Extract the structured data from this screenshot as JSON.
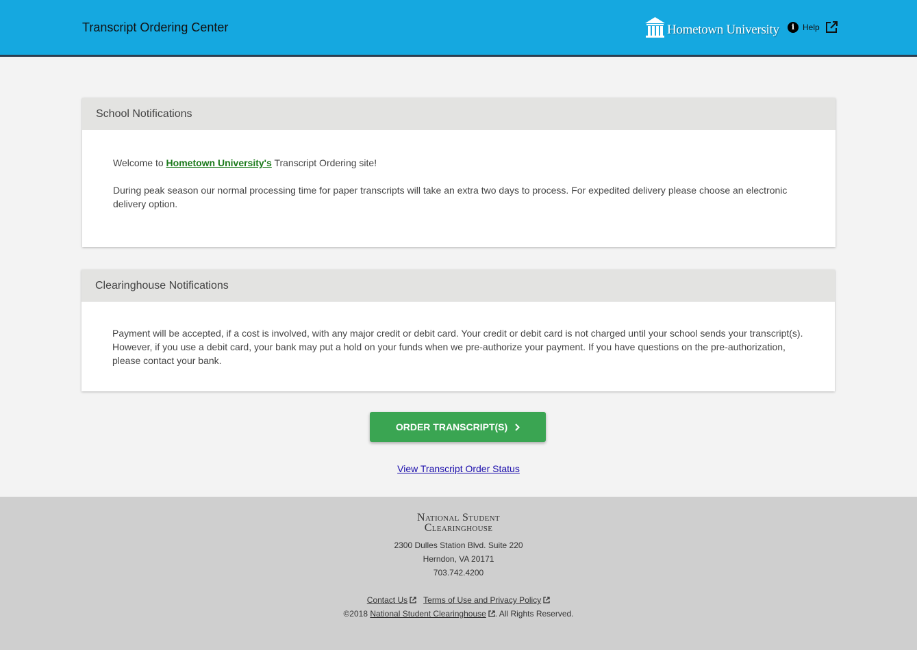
{
  "header": {
    "title": "Transcript Ordering Center",
    "brand": "Hometown University",
    "help_label": "Help"
  },
  "school_notifications": {
    "title": "School Notifications",
    "welcome_prefix": "Welcome to ",
    "welcome_link": "Hometown University's",
    "welcome_suffix": " Transcript Ordering site!",
    "message": "During peak season our normal processing time for paper transcripts will take an extra two days to process. For expedited delivery please choose an electronic delivery option."
  },
  "clearinghouse_notifications": {
    "title": "Clearinghouse Notifications",
    "message": "Payment will be accepted, if a cost is involved, with any major credit or debit card. Your credit or debit card is not charged until your school sends your transcript(s). However, if you use a debit card, your bank may put a hold on your funds when we pre-authorize your payment. If you have questions on the pre-authorization, please contact your bank."
  },
  "actions": {
    "order_button": "ORDER TRANSCRIPT(S)",
    "status_link": "View Transcript Order Status"
  },
  "footer": {
    "logo_line1": "National Student",
    "logo_line2": "Clearinghouse",
    "address_line1": "2300 Dulles Station Blvd. Suite 220",
    "address_line2": "Herndon, VA 20171",
    "phone": "703.742.4200",
    "contact_link": "Contact Us",
    "terms_link": "Terms of Use and Privacy Policy",
    "copyright_prefix": "©2018 ",
    "copyright_link": "National Student Clearinghouse",
    "copyright_suffix": ". All Rights Reserved."
  },
  "colors": {
    "header_bg": "#15a8e0",
    "button_green": "#3aa552",
    "link_green": "#1b7a1b"
  }
}
